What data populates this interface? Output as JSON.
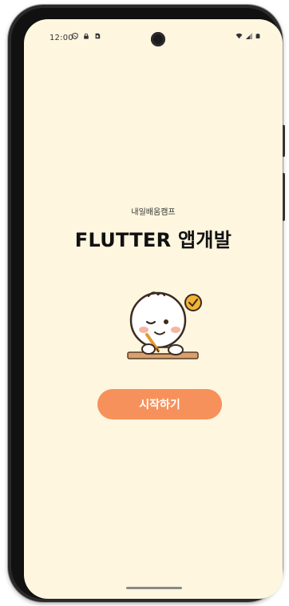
{
  "status_bar": {
    "time": "12:00",
    "left_icons": [
      "shield-icon",
      "lock-icon",
      "sd-card-icon"
    ],
    "right_icons": [
      "wifi-icon",
      "signal-icon",
      "battery-icon"
    ]
  },
  "main": {
    "subtitle": "내일배움캠프",
    "title": "FLUTTER 앱개발",
    "illustration": "child-writing-illustration",
    "start_button_label": "시작하기"
  },
  "colors": {
    "background": "#fef6df",
    "button": "#f7915c",
    "button_text": "#ffffff",
    "check_badge": "#f5b335"
  }
}
